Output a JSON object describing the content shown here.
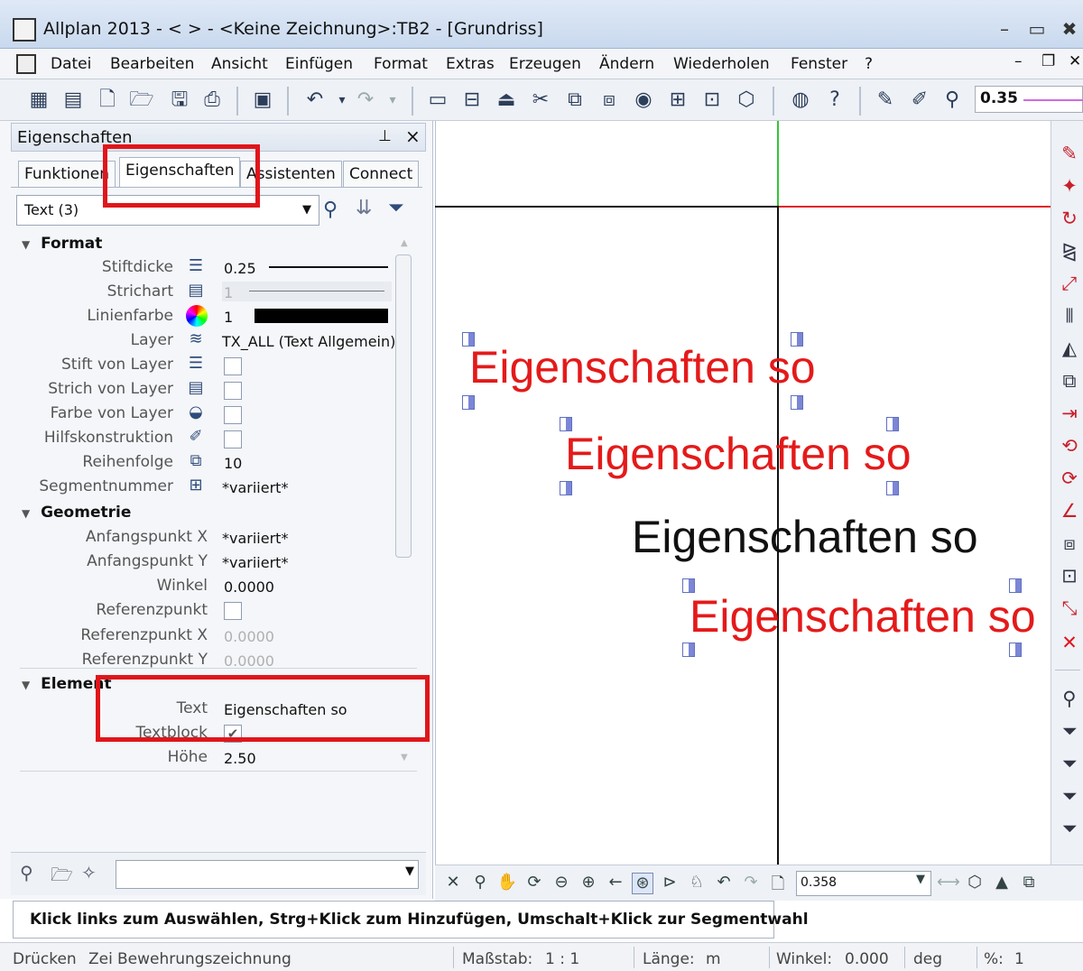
{
  "window": {
    "title": "Allplan 2013 - <        > - <Keine Zeichnung>:TB2 - [Grundriss]"
  },
  "menu": [
    "Datei",
    "Bearbeiten",
    "Ansicht",
    "Einfügen",
    "Format",
    "Extras",
    "Erzeugen",
    "Ändern",
    "Wiederholen",
    "Fenster",
    "?"
  ],
  "toolbar": {
    "pen_value": "0.35"
  },
  "palette": {
    "title": "Eigenschaften",
    "tabs": [
      "Funktionen",
      "Eigenschaften",
      "Assistenten",
      "Connect"
    ],
    "active_tab": "Eigenschaften",
    "object_filter": "Text (3)",
    "sections": {
      "format": {
        "title": "Format",
        "rows": [
          {
            "label": "Stiftdicke",
            "icon": "pen-thickness-icon",
            "value": "0.25"
          },
          {
            "label": "Strichart",
            "icon": "line-type-icon",
            "value": "1"
          },
          {
            "label": "Linienfarbe",
            "icon": "color-wheel-icon",
            "value": "1"
          },
          {
            "label": "Layer",
            "icon": "layer-icon",
            "value": "TX_ALL (Text Allgemein)"
          },
          {
            "label": "Stift von Layer",
            "icon": "pen-from-layer-icon"
          },
          {
            "label": "Strich von Layer",
            "icon": "line-from-layer-icon"
          },
          {
            "label": "Farbe von Layer",
            "icon": "color-from-layer-icon"
          },
          {
            "label": "Hilfskonstruktion",
            "icon": "construction-line-icon"
          },
          {
            "label": "Reihenfolge",
            "icon": "order-icon",
            "value": "10"
          },
          {
            "label": "Segmentnummer",
            "icon": "segment-icon",
            "value": "*variiert*"
          }
        ]
      },
      "geometrie": {
        "title": "Geometrie",
        "rows": [
          {
            "label": "Anfangspunkt X",
            "value": "*variiert*"
          },
          {
            "label": "Anfangspunkt Y",
            "value": "*variiert*"
          },
          {
            "label": "Winkel",
            "value": "0.0000"
          },
          {
            "label": "Referenzpunkt"
          },
          {
            "label": "Referenzpunkt X",
            "value": "0.0000"
          },
          {
            "label": "Referenzpunkt Y",
            "value": "0.0000"
          }
        ]
      },
      "element": {
        "title": "Element",
        "rows": [
          {
            "label": "Text",
            "value": "Eigenschaften so"
          },
          {
            "label": "Textblock"
          },
          {
            "label": "Höhe",
            "value": "2.50"
          }
        ]
      }
    }
  },
  "canvas": {
    "texts": [
      "Eigenschaften so",
      "Eigenschaften so",
      "Eigenschaften so",
      "Eigenschaften so"
    ],
    "zoom_value": "0.358"
  },
  "hint": "Klick links zum Auswählen, Strg+Klick zum Hinzufügen, Umschalt+Klick zur Segmentwahl",
  "status": {
    "press": "Drücken",
    "drawing_type_label": "Zei",
    "drawing_type": "Bewehrungszeichnung",
    "scale_label": "Maßstab:",
    "scale": "1 : 1",
    "length_label": "Länge:",
    "length_unit": "m",
    "angle_label": "Winkel:",
    "angle": "0.000",
    "angle_unit": "deg",
    "percent_label": "%:",
    "percent": "1"
  },
  "colors": {
    "highlight": "#e0161b",
    "text_selected": "#e41a1a",
    "axis_green": "#36c436",
    "axis_red": "#e02020"
  }
}
